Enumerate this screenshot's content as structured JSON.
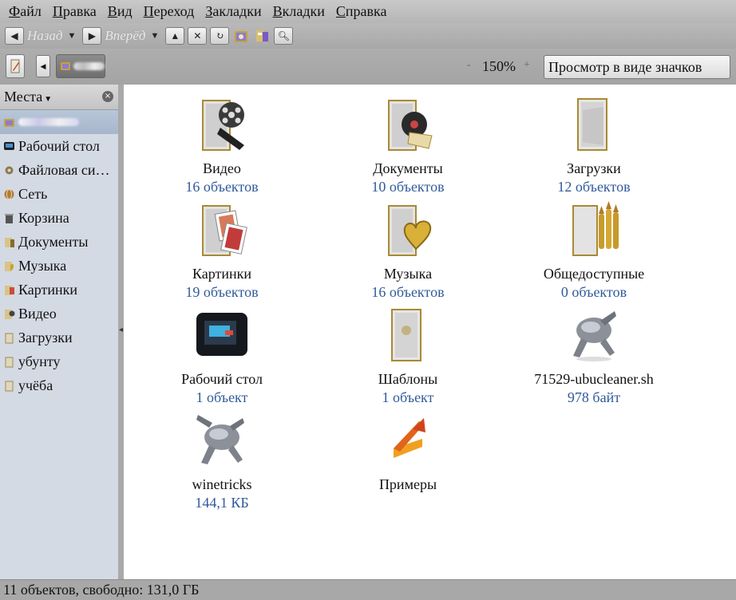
{
  "menubar": {
    "items": [
      {
        "label": "Файл"
      },
      {
        "label": "Правка"
      },
      {
        "label": "Вид"
      },
      {
        "label": "Переход"
      },
      {
        "label": "Закладки"
      },
      {
        "label": "Вкладки"
      },
      {
        "label": "Справка"
      }
    ]
  },
  "toolbar": {
    "back_label": "Назад",
    "forward_label": "Вперёд"
  },
  "location": {
    "zoom": "150%",
    "zoom_minus": "-",
    "zoom_plus": "+",
    "view_mode": "Просмотр в виде значков"
  },
  "sidebar": {
    "title": "Места",
    "items": [
      {
        "label": "Рабочий стол",
        "icon": "desktop-icon"
      },
      {
        "label": "Файловая си…",
        "icon": "filesystem-icon"
      },
      {
        "label": "Сеть",
        "icon": "network-icon"
      },
      {
        "label": "Корзина",
        "icon": "trash-icon"
      },
      {
        "label": "Документы",
        "icon": "documents-folder-icon"
      },
      {
        "label": "Музыка",
        "icon": "music-folder-icon"
      },
      {
        "label": "Картинки",
        "icon": "pictures-folder-icon"
      },
      {
        "label": "Видео",
        "icon": "video-folder-icon"
      },
      {
        "label": "Загрузки",
        "icon": "downloads-folder-icon"
      },
      {
        "label": "убунту",
        "icon": "folder-icon"
      },
      {
        "label": "учёба",
        "icon": "folder-icon"
      }
    ]
  },
  "files": [
    {
      "name": "Видео",
      "meta": "16 объектов",
      "icon": "video-folder-icon"
    },
    {
      "name": "Документы",
      "meta": "10 объектов",
      "icon": "documents-folder-icon"
    },
    {
      "name": "Загрузки",
      "meta": "12 объектов",
      "icon": "downloads-folder-icon"
    },
    {
      "name": "Картинки",
      "meta": "19 объектов",
      "icon": "pictures-folder-icon"
    },
    {
      "name": "Музыка",
      "meta": "16 объектов",
      "icon": "music-folder-icon"
    },
    {
      "name": "Общедоступные",
      "meta": "0 объектов",
      "icon": "public-folder-icon"
    },
    {
      "name": "Рабочий стол",
      "meta": "1 объект",
      "icon": "desktop-folder-icon"
    },
    {
      "name": "Шаблоны",
      "meta": "1 объект",
      "icon": "templates-folder-icon"
    },
    {
      "name": "71529-ubucleaner.sh",
      "meta": "978 байт",
      "icon": "script-icon"
    },
    {
      "name": "winetricks",
      "meta": "144,1 КБ",
      "icon": "script-icon"
    },
    {
      "name": "Примеры",
      "meta": "",
      "icon": "examples-link-icon"
    }
  ],
  "status": {
    "text": "11 объектов, свободно: 131,0 ГБ"
  },
  "colors": {
    "meta_text": "#2f5a9c",
    "sidebar_bg": "#d4dae3",
    "selected_bg": "#b0bfd3",
    "chrome_bg": "#a9a9a9"
  }
}
